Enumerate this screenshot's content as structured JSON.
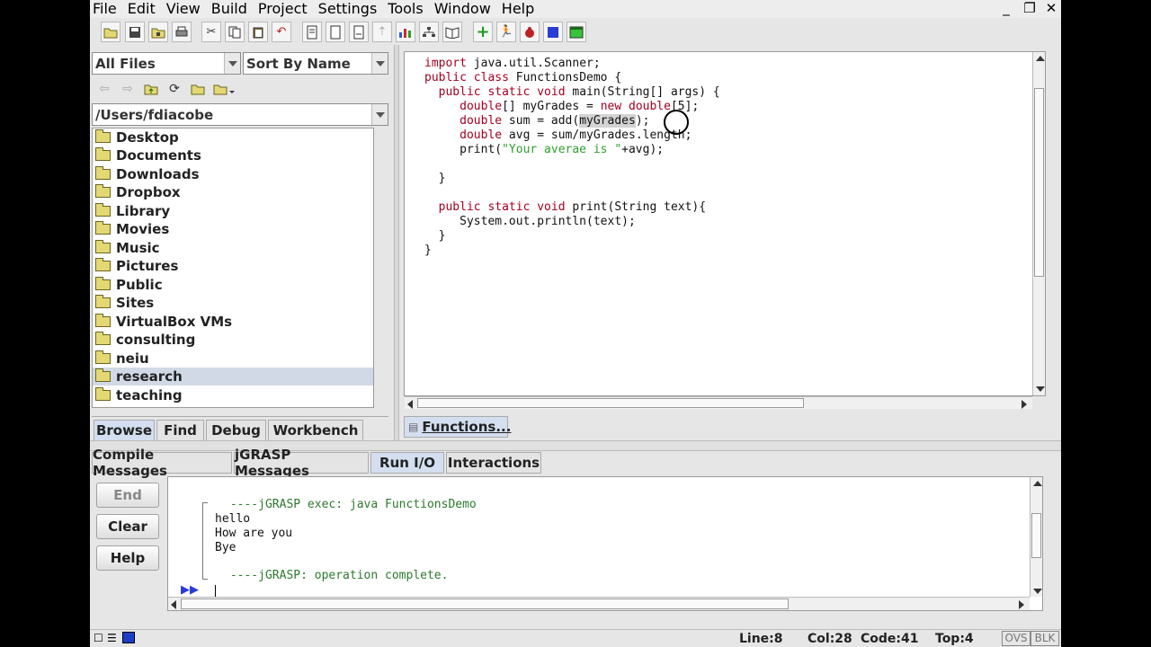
{
  "menu": [
    "File",
    "Edit",
    "View",
    "Build",
    "Project",
    "Settings",
    "Tools",
    "Window",
    "Help"
  ],
  "window_controls": {
    "minimize": "_",
    "restore": "❐",
    "close": "✕"
  },
  "toolbar_icons": [
    "open-folder-icon",
    "save-icon",
    "open-project-icon",
    "print-icon",
    "cut-icon",
    "copy-icon",
    "paste-icon",
    "undo-icon",
    "generate-doc-icon",
    "page-icon",
    "page2-icon",
    "pin-icon",
    "bar-chart-icon",
    "tree-icon",
    "book-icon",
    "add-icon",
    "run-figure-icon",
    "bug-icon",
    "blue-square-icon",
    "green-window-icon"
  ],
  "browser": {
    "filter": "All Files",
    "sort": "Sort By Name",
    "path": "/Users/fdiacobe",
    "files": [
      "Desktop",
      "Documents",
      "Downloads",
      "Dropbox",
      "Library",
      "Movies",
      "Music",
      "Pictures",
      "Public",
      "Sites",
      "VirtualBox VMs",
      "consulting",
      "neiu",
      "research",
      "teaching"
    ],
    "selected": "research",
    "tabs": [
      "Browse",
      "Find",
      "Debug",
      "Workbench"
    ],
    "active_tab": "Browse"
  },
  "editor": {
    "lines": [
      "import java.util.Scanner;",
      "public class FunctionsDemo {",
      "  public static void main(String[] args) {",
      "     double[] myGrades = new double[5];",
      "     double sum = add(myGrades);",
      "     double avg = sum/myGrades.length;",
      "     print(\"Your averae is \"+avg);",
      "",
      "  }",
      "",
      "  public static void print(String text){",
      "     System.out.println(text);",
      "  }",
      "}"
    ],
    "doc_tab": "Functions..."
  },
  "messages": {
    "tabs": [
      "Compile Messages",
      "jGRASP Messages",
      "Run I/O",
      "Interactions"
    ],
    "active_tab": "Run I/O",
    "buttons": {
      "end": "End",
      "clear": "Clear",
      "help": "Help"
    },
    "console": {
      "exec": " ----jGRASP exec: java FunctionsDemo",
      "out1": "hello",
      "out2": "How are you",
      "out3": "Bye",
      "done": " ----jGRASP: operation complete.",
      "prompt": "▶▶"
    }
  },
  "status": {
    "line": "Line:8",
    "col": "Col:28",
    "code": "Code:41",
    "top": "Top:4",
    "ovs": "OVS",
    "blk": "BLK"
  },
  "colors": {
    "keyword": "#a50021",
    "string": "#2ea02e",
    "console_text": "#2c7a2c",
    "selection": "#d1d9e6",
    "active_tab": "#d3dff0"
  }
}
